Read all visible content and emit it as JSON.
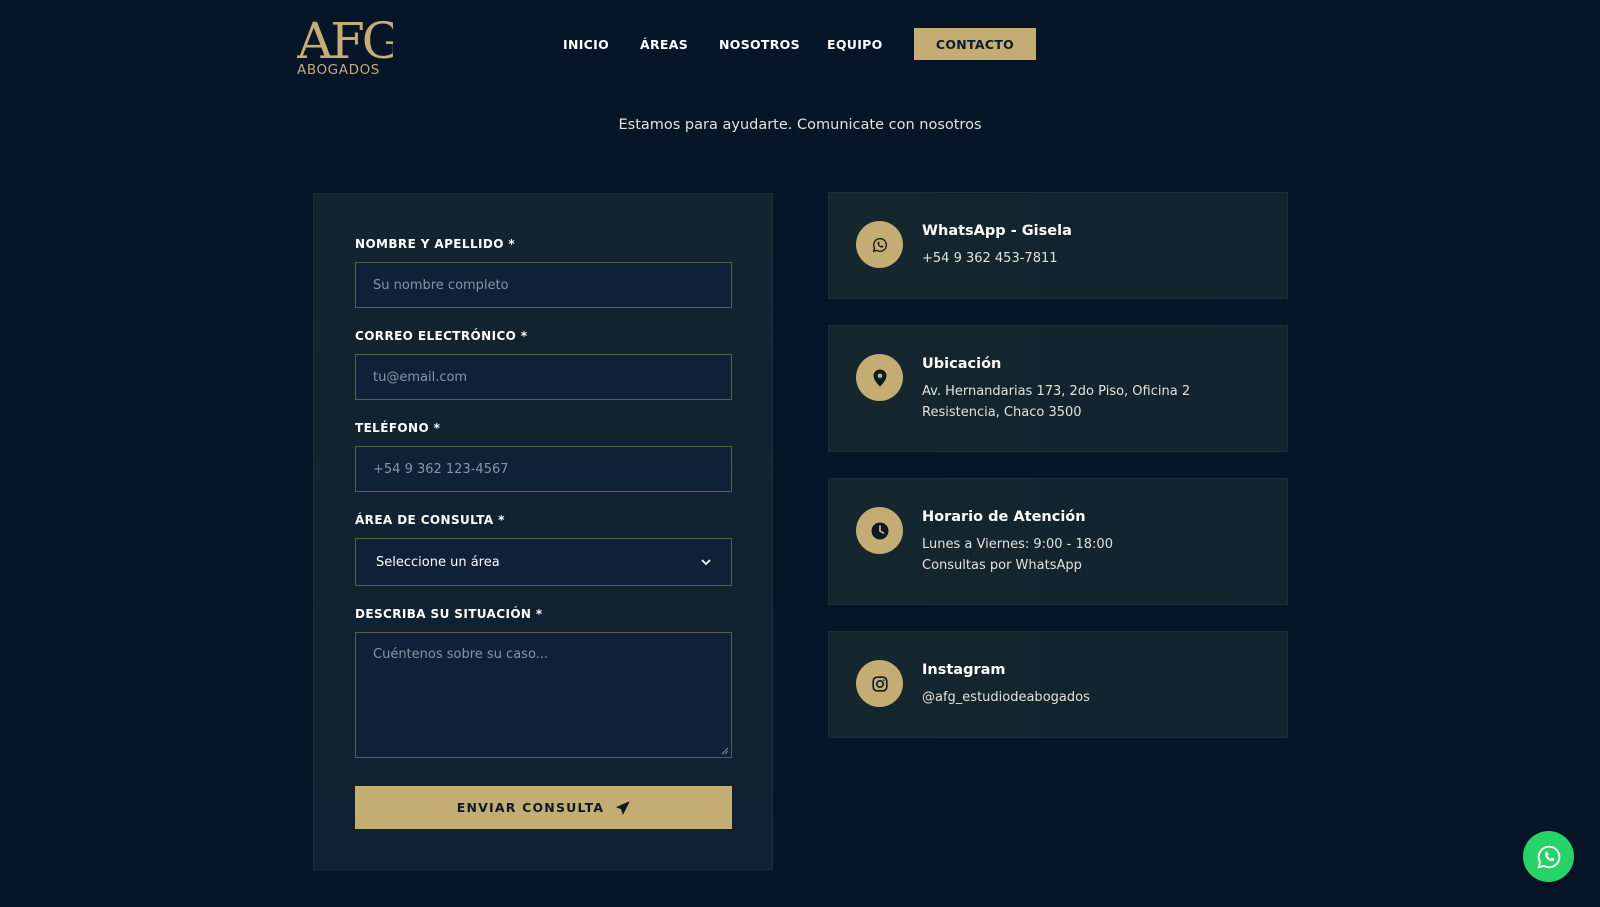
{
  "brand": {
    "logo_mark": "AFG",
    "logo_sub": "ABOGADOS",
    "accent_color": "#c4ad73",
    "background_color": "#061528",
    "whatsapp_color": "#25d366"
  },
  "nav": {
    "items": [
      {
        "label": "INICIO"
      },
      {
        "label": "ÁREAS"
      },
      {
        "label": "NOSOTROS"
      },
      {
        "label": "EQUIPO"
      }
    ],
    "cta_label": "CONTACTO"
  },
  "hero": {
    "subtitle": "Estamos para ayudarte. Comunicate con nosotros"
  },
  "form": {
    "name": {
      "label": "NOMBRE Y APELLIDO *",
      "placeholder": "Su nombre completo"
    },
    "email": {
      "label": "CORREO ELECTRÓNICO *",
      "placeholder": "tu@email.com"
    },
    "phone": {
      "label": "TELÉFONO *",
      "placeholder": "+54 9 362 123-4567"
    },
    "area": {
      "label": "ÁREA DE CONSULTA *",
      "selected": "Seleccione un área"
    },
    "message": {
      "label": "DESCRIBA SU SITUACIÓN *",
      "placeholder": "Cuéntenos sobre su caso..."
    },
    "submit_label": "ENVIAR CONSULTA",
    "submit_icon": "paper-plane-icon"
  },
  "contact_cards": [
    {
      "icon": "whatsapp-icon",
      "title": "WhatsApp - Gisela",
      "lines": [
        "+54 9 362 453-7811"
      ]
    },
    {
      "icon": "location-pin-icon",
      "title": "Ubicación",
      "lines": [
        "Av. Hernandarias 173, 2do Piso, Oficina 2",
        "Resistencia, Chaco 3500"
      ]
    },
    {
      "icon": "clock-icon",
      "title": "Horario de Atención",
      "lines": [
        "Lunes a Viernes: 9:00 - 18:00",
        "Consultas por WhatsApp"
      ]
    },
    {
      "icon": "instagram-icon",
      "title": "Instagram",
      "lines": [
        "@afg_estudiodeabogados"
      ]
    }
  ],
  "floating_button": {
    "icon": "whatsapp-icon"
  }
}
